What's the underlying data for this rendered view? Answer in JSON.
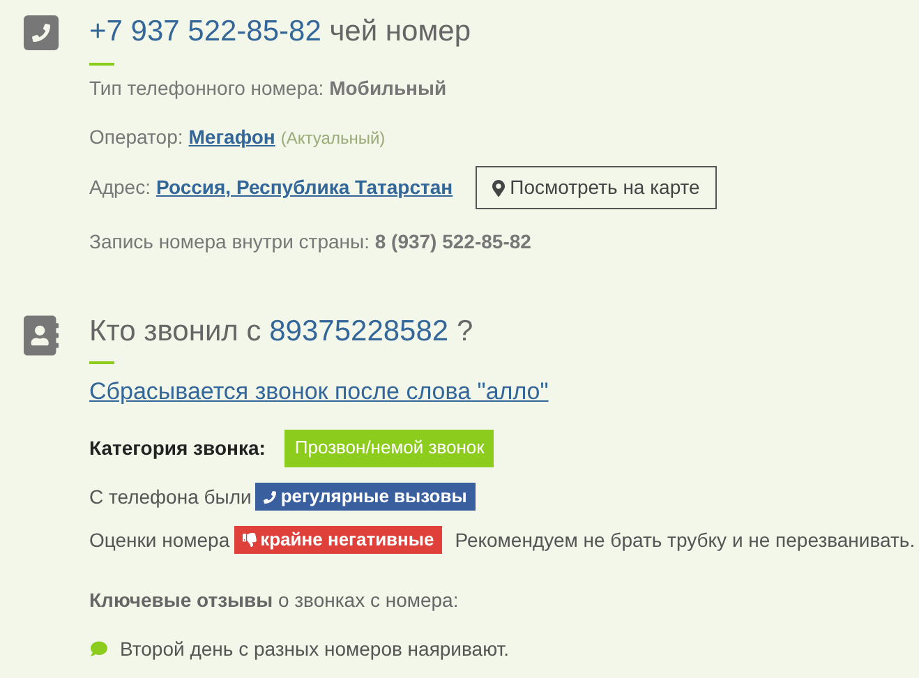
{
  "number_section": {
    "title_number": "+7 937 522-85-82",
    "title_suffix": "чей номер",
    "phone_type": "Тип телефонного номера: **Мобильный**",
    "operator_label": "Оператор:",
    "operator_link": "Мегафон",
    "operator_note": "(Актуальный)",
    "address_label": "Адрес:",
    "address_link": "Россия, Республика Татарстан",
    "map_button": "Посмотреть на карте",
    "domestic_format": "Запись номера внутри страны: **8 (937) 522-85-82**"
  },
  "caller_section": {
    "title_prefix": "Кто звонил с",
    "title_number": "89375228582",
    "title_suffix": "?",
    "headline_link": "Сбрасывается звонок после слова \"алло\"",
    "category_label": "Категория звонка:",
    "category_badge": "Прозвон/немой звонок",
    "calls_label": "С телефона были",
    "calls_badge": "регулярные вызовы",
    "ratings_label": "Оценки номера",
    "ratings_badge": "крайне негативные",
    "ratings_advice": "Рекомендуем не брать трубку и не перезванивать.",
    "reviews_heading": "**Ключевые отзывы** о звонках с номера:",
    "reviews": [
      "Второй день с разных номеров наяривают."
    ]
  }
}
